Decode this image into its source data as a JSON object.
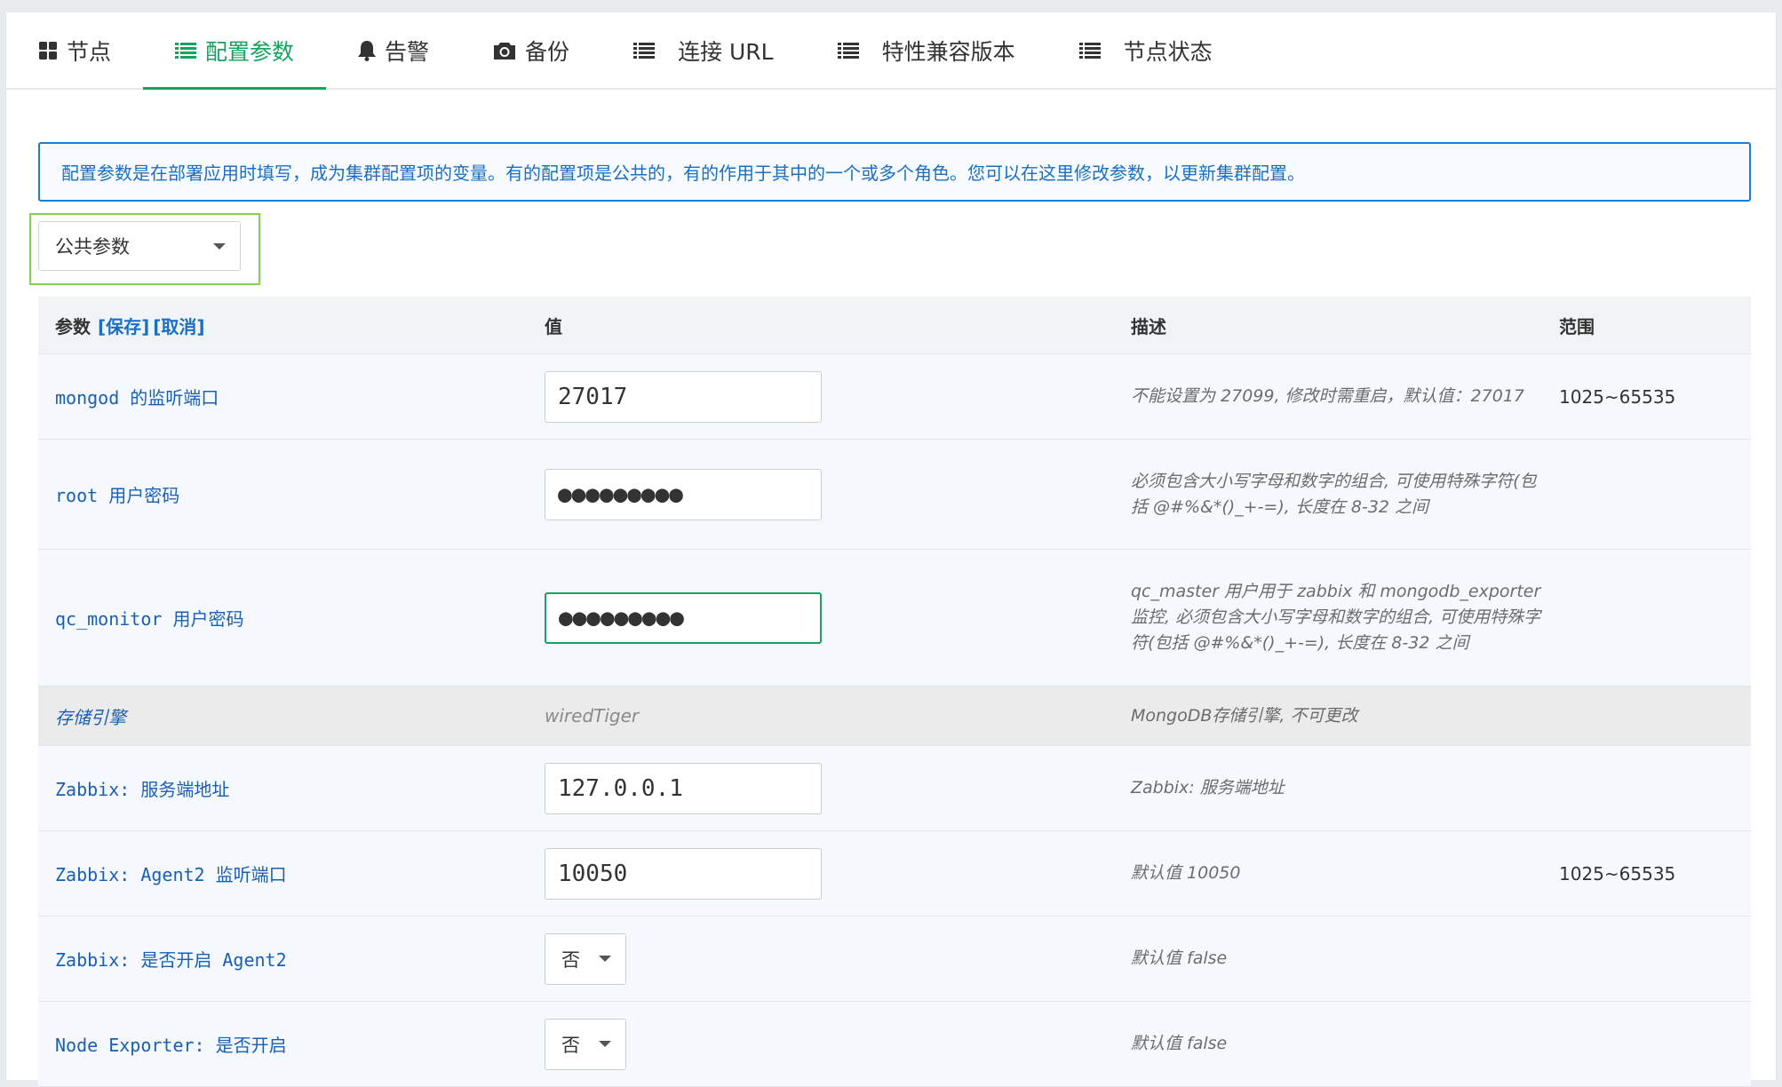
{
  "tabs": [
    {
      "label": "节点",
      "icon": "grid-icon"
    },
    {
      "label": "配置参数",
      "icon": "list-icon",
      "active": true
    },
    {
      "label": "告警",
      "icon": "bell-icon"
    },
    {
      "label": "备份",
      "icon": "camera-icon"
    },
    {
      "label": "连接 URL",
      "icon": "list-icon"
    },
    {
      "label": "特性兼容版本",
      "icon": "list-icon"
    },
    {
      "label": "节点状态",
      "icon": "list-icon"
    }
  ],
  "info": "配置参数是在部署应用时填写，成为集群配置项的变量。有的配置项是公共的，有的作用于其中的一个或多个角色。您可以在这里修改参数，以更新集群配置。",
  "role_select": {
    "value": "公共参数"
  },
  "table": {
    "headers": {
      "param": "参数",
      "save": "[保存]",
      "cancel": "[取消]",
      "value": "值",
      "desc": "描述",
      "range": "范围"
    },
    "rows": [
      {
        "param": "mongod 的监听端口",
        "value": "27017",
        "desc": "不能设置为 27099, 修改时需重启，默认值：27017",
        "range": "1025~65535"
      },
      {
        "param": "root 用户密码",
        "value": "●●●●●●●●●",
        "desc": "必须包含大小写字母和数字的组合, 可使用特殊字符(包括 @#%&*()_+-=), 长度在 8-32 之间",
        "range": ""
      },
      {
        "param": "qc_monitor 用户密码",
        "value": "●●●●●●●●●",
        "desc": "qc_master 用户用于 zabbix 和 mongodb_exporter 监控, 必须包含大小写字母和数字的组合, 可使用特殊字符(包括 @#%&*()_+-=), 长度在 8-32 之间",
        "range": ""
      },
      {
        "param": "存储引擎",
        "value": "wiredTiger",
        "desc": "MongoDB存储引擎, 不可更改",
        "range": ""
      },
      {
        "param": "Zabbix: 服务端地址",
        "value": "127.0.0.1",
        "desc": "Zabbix: 服务端地址",
        "range": ""
      },
      {
        "param": "Zabbix: Agent2 监听端口",
        "value": "10050",
        "desc": "默认值 10050",
        "range": "1025~65535"
      },
      {
        "param": "Zabbix: 是否开启 Agent2",
        "value": "否",
        "desc": "默认值 false",
        "range": ""
      },
      {
        "param": "Node Exporter: 是否开启",
        "value": "否",
        "desc": "默认值 false",
        "range": ""
      }
    ]
  },
  "colors": {
    "accent": "#16a35f",
    "link": "#1a6fc4",
    "highlight": "#7fd34e"
  }
}
